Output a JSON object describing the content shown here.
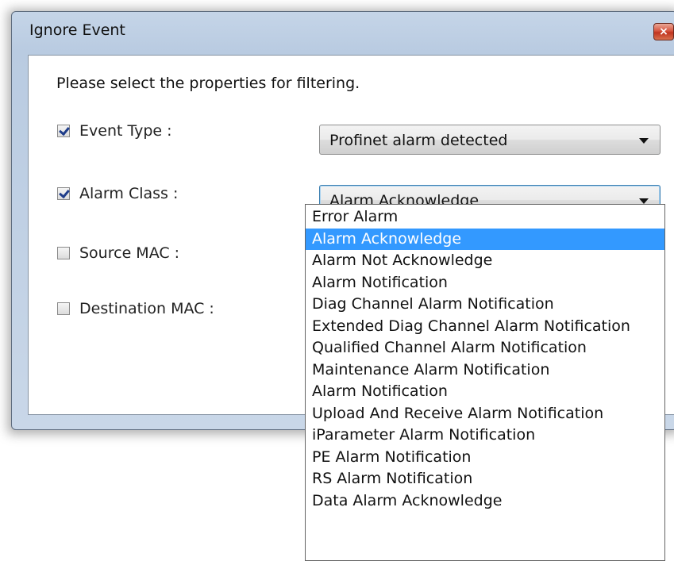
{
  "dialog": {
    "title": "Ignore Event",
    "close_glyph": "×",
    "instruction": "Please select the properties for filtering."
  },
  "fields": [
    {
      "label": "Event Type  :",
      "checked": true,
      "combo_value": "Profinet alarm detected"
    },
    {
      "label": "Alarm Class  :",
      "checked": true,
      "combo_value": "Alarm Acknowledge"
    },
    {
      "label": "Source MAC  :",
      "checked": false
    },
    {
      "label": "Destination MAC  :",
      "checked": false
    }
  ],
  "alarm_class_dropdown": {
    "selected_index": 1,
    "options": [
      "Error Alarm",
      "Alarm Acknowledge",
      "Alarm Not Acknowledge",
      "Alarm Notification",
      "Diag Channel Alarm Notification",
      "Extended Diag Channel Alarm Notification",
      "Qualified Channel Alarm Notification",
      "Maintenance Alarm Notification",
      "Alarm Notification",
      "Upload And Receive Alarm Notification",
      "iParameter Alarm Notification",
      "PE Alarm Notification",
      "RS Alarm Notification",
      "Data Alarm Acknowledge"
    ]
  },
  "colors": {
    "selection": "#3399ff",
    "close_button": "#c0341f",
    "checkmark": "#1f3d8a"
  }
}
